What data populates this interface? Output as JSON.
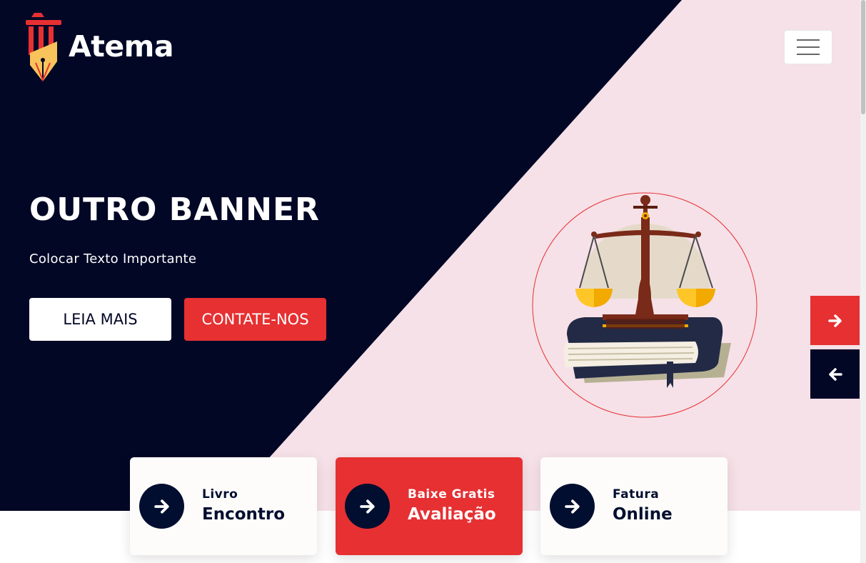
{
  "brand": {
    "name": "Atema",
    "logo_icon": "pen-column-icon"
  },
  "header": {
    "menu_icon": "hamburger-icon"
  },
  "hero": {
    "title": "OUTRO BANNER",
    "subtitle": "Colocar Texto Importante",
    "primary_button": "LEIA MAIS",
    "secondary_button": "CONTATE-NOS",
    "illustration": "scales-of-justice-on-book-icon"
  },
  "slider": {
    "next_icon": "arrow-right-icon",
    "prev_icon": "arrow-left-icon"
  },
  "cards": [
    {
      "small": "Livro",
      "big": "Encontro",
      "icon": "arrow-right-icon"
    },
    {
      "small": "Baixe Gratis",
      "big": "Avaliação",
      "icon": "arrow-right-icon"
    },
    {
      "small": "Fatura",
      "big": "Online",
      "icon": "arrow-right-icon"
    }
  ],
  "colors": {
    "navy": "#020726",
    "red": "#e63032",
    "pink": "#f6e1e8",
    "white": "#ffffff"
  }
}
